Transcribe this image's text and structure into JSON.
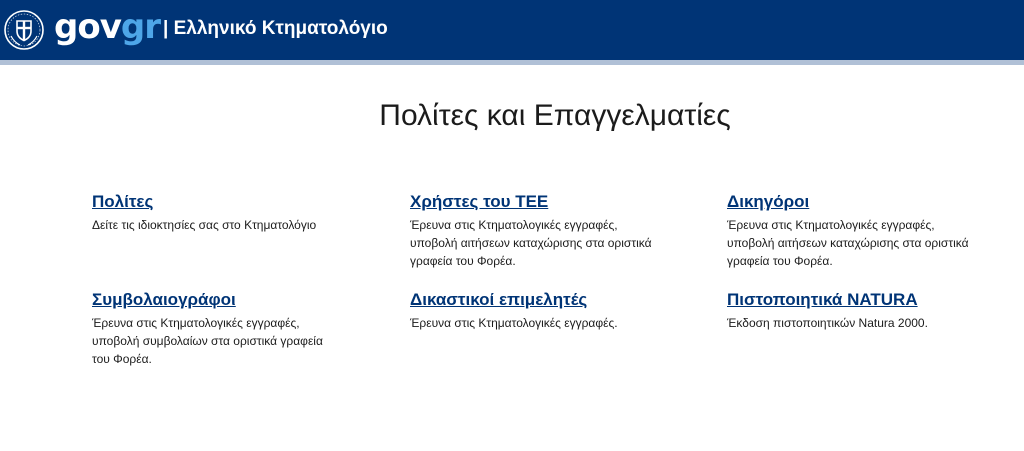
{
  "header": {
    "logo_part1": "gov",
    "logo_part2": "gr",
    "site_title": "| Ελληνικό Κτηματολόγιο"
  },
  "main": {
    "title": "Πολίτες και Επαγγελματίες",
    "cards": [
      {
        "label": "Πολίτες",
        "description": "Δείτε τις ιδιοκτησίες σας στο Κτηματολόγιο"
      },
      {
        "label": "Χρήστες του ΤΕΕ",
        "description": "Έρευνα στις Κτηματολογικές εγγραφές, υποβολή αιτήσεων καταχώρισης στα οριστικά γραφεία του Φορέα."
      },
      {
        "label": "Δικηγόροι",
        "description": "Έρευνα στις Κτηματολογικές εγγραφές, υποβολή αιτήσεων καταχώρισης στα οριστικά γραφεία του Φορέα."
      },
      {
        "label": "Συμβολαιογράφοι",
        "description": "Έρευνα στις Κτηματολογικές εγγραφές, υποβολή συμβολαίων στα οριστικά γραφεία του Φορέα."
      },
      {
        "label": "Δικαστικοί επιμελητές",
        "description": "Έρευνα στις Κτηματολογικές εγγραφές."
      },
      {
        "label": "Πιστοποιητικά NATURA",
        "description": "Έκδοση πιστοποιητικών Natura 2000."
      }
    ]
  },
  "colors": {
    "header_bg": "#003476",
    "link": "#003476",
    "logo_accent": "#4ea6e8"
  },
  "icons": {
    "emblem": "hellenic-republic-emblem-icon"
  }
}
